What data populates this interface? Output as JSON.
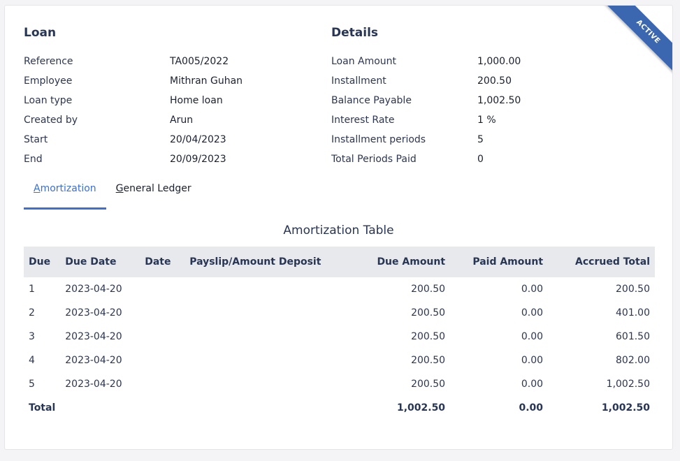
{
  "status_ribbon": "ACTIVE",
  "loan": {
    "title": "Loan",
    "fields": [
      {
        "label": "Reference",
        "value": "TA005/2022"
      },
      {
        "label": "Employee",
        "value": "Mithran Guhan"
      },
      {
        "label": "Loan type",
        "value": "Home loan"
      },
      {
        "label": "Created by",
        "value": "Arun"
      },
      {
        "label": "Start",
        "value": "20/04/2023"
      },
      {
        "label": "End",
        "value": "20/09/2023"
      }
    ]
  },
  "details": {
    "title": "Details",
    "fields": [
      {
        "label": "Loan Amount",
        "value": "1,000.00"
      },
      {
        "label": "Installment",
        "value": "200.50"
      },
      {
        "label": "Balance Payable",
        "value": "1,002.50"
      },
      {
        "label": "Interest Rate",
        "value": "1 %"
      },
      {
        "label": "Installment periods",
        "value": "5"
      },
      {
        "label": "Total Periods Paid",
        "value": "0"
      }
    ]
  },
  "tabs": [
    {
      "first": "A",
      "rest": "mortization",
      "active": true
    },
    {
      "first": "G",
      "rest": "eneral Ledger",
      "active": false
    }
  ],
  "table": {
    "title": "Amortization Table",
    "headers": [
      "Due",
      "Due Date",
      "Date",
      "Payslip/Amount Deposit",
      "Due Amount",
      "Paid Amount",
      "Accrued Total"
    ],
    "rows": [
      {
        "due": "1",
        "due_date": "2023-04-20",
        "date": "",
        "payslip": "",
        "due_amount": "200.50",
        "paid_amount": "0.00",
        "accrued_total": "200.50"
      },
      {
        "due": "2",
        "due_date": "2023-04-20",
        "date": "",
        "payslip": "",
        "due_amount": "200.50",
        "paid_amount": "0.00",
        "accrued_total": "401.00"
      },
      {
        "due": "3",
        "due_date": "2023-04-20",
        "date": "",
        "payslip": "",
        "due_amount": "200.50",
        "paid_amount": "0.00",
        "accrued_total": "601.50"
      },
      {
        "due": "4",
        "due_date": "2023-04-20",
        "date": "",
        "payslip": "",
        "due_amount": "200.50",
        "paid_amount": "0.00",
        "accrued_total": "802.00"
      },
      {
        "due": "5",
        "due_date": "2023-04-20",
        "date": "",
        "payslip": "",
        "due_amount": "200.50",
        "paid_amount": "0.00",
        "accrued_total": "1,002.50"
      }
    ],
    "total": {
      "label": "Total",
      "due_amount": "1,002.50",
      "paid_amount": "0.00",
      "accrued_total": "1,002.50"
    }
  },
  "colors": {
    "accent": "#3b6fd8",
    "ribbon": "#3b67b0",
    "header_bg": "#e8e9ec"
  }
}
